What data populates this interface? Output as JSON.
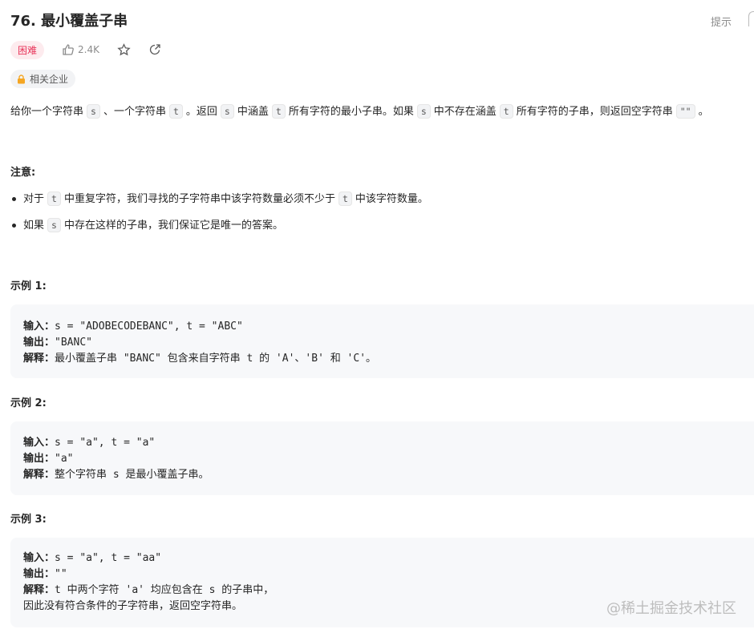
{
  "header": {
    "title": "76. 最小覆盖子串",
    "hint_label": "提示"
  },
  "meta": {
    "difficulty": "困难",
    "likes": "2.4K",
    "company_label": "相关企业"
  },
  "description": {
    "p1_a": "给你一个字符串",
    "code_s": "s",
    "p1_b": "、一个字符串",
    "code_t": "t",
    "p1_c": "。返回",
    "p1_d": "中涵盖",
    "p1_e": "所有字符的最小子串。如果",
    "p1_f": "中不存在涵盖",
    "p1_g": "所有字符的子串，则返回空字符串",
    "code_empty": "\"\"",
    "p1_h": "。"
  },
  "notes": {
    "title": "注意:",
    "item1_a": "对于",
    "item1_b": "中重复字符，我们寻找的子字符串中该字符数量必须不少于",
    "item1_c": "中该字符数量。",
    "item2_a": "如果",
    "item2_b": "中存在这样的子串，我们保证它是唯一的答案。"
  },
  "examples": [
    {
      "title": "示例 1:",
      "input_label": "输入：",
      "input": "s = \"ADOBECODEBANC\", t = \"ABC\"",
      "output_label": "输出：",
      "output": "\"BANC\"",
      "explain_label": "解释：",
      "explain": [
        "最小覆盖子串 \"BANC\" 包含来自字符串 t 的 'A'、'B' 和 'C'。"
      ]
    },
    {
      "title": "示例 2:",
      "input_label": "输入：",
      "input": "s = \"a\", t = \"a\"",
      "output_label": "输出：",
      "output": "\"a\"",
      "explain_label": "解释：",
      "explain": [
        "整个字符串 s 是最小覆盖子串。"
      ]
    },
    {
      "title": "示例 3:",
      "input_label": "输入：",
      "input": "s = \"a\", t = \"aa\"",
      "output_label": "输出：",
      "output": "\"\"",
      "explain_label": "解释：",
      "explain": [
        "t 中两个字符 'a' 均应包含在 s 的子串中，",
        "因此没有符合条件的子字符串，返回空字符串。"
      ]
    }
  ],
  "watermark": "@稀土掘金技术社区",
  "colors": {
    "hard_bg": "#fdebee",
    "hard_text": "#e8355a",
    "lock": "#f5a623",
    "example_bg": "#f7f8fa"
  }
}
